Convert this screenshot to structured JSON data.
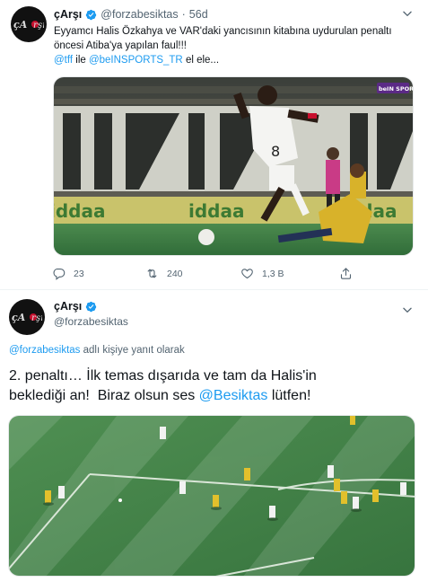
{
  "tweet1": {
    "author_name": "çArşı",
    "handle": "@forzabesiktas",
    "separator": "·",
    "time": "56d",
    "text_line1": "Eyyamcı Halis Özkahya ve VAR'daki yancısının kitabına uydurulan penaltı",
    "text_line2": "öncesi Atiba'ya yapılan faul!!!",
    "mention1": "@tff",
    "connector": " ile ",
    "mention2": "@beINSPORTS_TR",
    "tail": " el ele...",
    "media_label": "photo",
    "replies": "23",
    "retweets": "240",
    "likes": "1,3 B",
    "broadcaster_tag": "beIN SPORTS",
    "board_text": "iddaa",
    "jersey_number": "8"
  },
  "tweet2": {
    "author_name": "çArşı",
    "handle": "@forzabesiktas",
    "reply_mention": "@forzabesiktas",
    "reply_suffix": " adlı kişiye yanıt olarak",
    "text_line1": "2. penaltı… İlk temas dışarıda ve tam da Halis'in",
    "text_line2_a": "beklediği an!  Biraz olsun ses ",
    "text_mention": "@Besiktas",
    "text_line2_b": " lütfen!"
  },
  "colors": {
    "link": "#1d9bf0",
    "secondary_text": "#536471",
    "pitch": "#3f7d45",
    "verified": "#1d9bf0"
  },
  "icons": [
    "verified-badge-icon",
    "caret-down-icon",
    "reply-icon",
    "retweet-icon",
    "like-icon",
    "share-icon",
    "profile-avatar-logo"
  ]
}
